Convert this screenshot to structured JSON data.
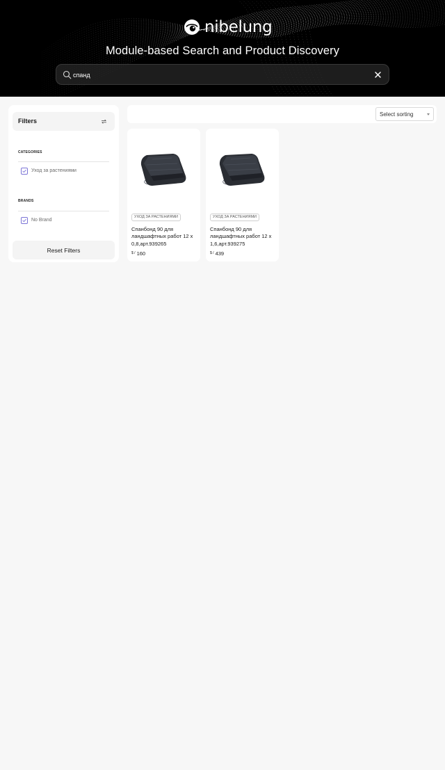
{
  "header": {
    "logo_text": "nibelung",
    "title": "Module-based Search and Product Discovery",
    "search": {
      "value": "спанд",
      "placeholder": ""
    }
  },
  "sidebar": {
    "title": "Filters",
    "categories": {
      "heading": "CATEGORIES",
      "items": [
        {
          "label": "Уход за растениями",
          "checked": true
        }
      ]
    },
    "brands": {
      "heading": "BRANDS",
      "items": [
        {
          "label": "No Brand",
          "checked": true
        }
      ]
    },
    "reset_label": "Reset Filters"
  },
  "toolbar": {
    "sort_label": "Select sorting"
  },
  "products": [
    {
      "category": "УХОД ЗА РАСТЕНИЯМИ",
      "title": "Спанбонд 90 для ландшафтных работ 12 х 0,8,арт.939265",
      "currency": "$ /",
      "price": "160"
    },
    {
      "category": "УХОД ЗА РАСТЕНИЯМИ",
      "title": "Спанбонд 90 для ландшафтных работ 12 х 1,6,арт.939275",
      "currency": "$ /",
      "price": "439"
    }
  ],
  "colors": {
    "hero_bg": "#000000",
    "page_bg": "#f7f7f7",
    "checkbox_accent": "#7b74d6"
  },
  "icons": [
    "logo-mark-icon",
    "search-icon",
    "close-icon",
    "refresh-icon",
    "check-icon",
    "chevron-down-icon"
  ]
}
